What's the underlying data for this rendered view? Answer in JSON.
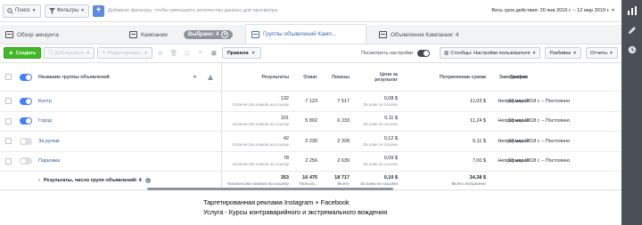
{
  "topbar": {
    "search_label": "Поиск",
    "filters_label": "Фильтры",
    "add_filter_hint": "Добавьте фильтры, чтобы уменьшить количество данных для просмотра",
    "date_range": "Весь срок действия: 20 янв 2016 г. – 12 мар 2019 г."
  },
  "tabs": {
    "overview": "Обзор аккаунта",
    "campaigns": "Кампании",
    "selected_pill": "Выбрано: 4",
    "adsets": "Группы объявлений Камп...",
    "ads": "Объявления Кампании: 4"
  },
  "toolbar": {
    "create": "Создать",
    "duplicate": "Дублировать",
    "edit": "Редактировать",
    "rules": "Правила",
    "view_settings": "Посмотреть настройки",
    "columns": "Столбцы: Настройки пользователя",
    "breakdown": "Разбивка",
    "reports": "Отчеты"
  },
  "table": {
    "headers": {
      "name": "Название группы объявлений",
      "results": "Результаты",
      "reach": "Охват",
      "impressions": "Показы",
      "cost": "Цена за результат",
      "spend": "Потраченная сумма",
      "end": "Завершение",
      "schedule": "График"
    },
    "rows": [
      {
        "name": "Контр",
        "active": true,
        "results": "132",
        "results_sub": "Количество кликов на ссылку",
        "reach": "7 123",
        "impressions": "7 517",
        "cost": "0,08 $",
        "cost_sub": "За клик по ссылке",
        "spend": "11,03 $",
        "end": "Непрерывная",
        "schedule": "13 мар 2018 г. – Постоянно"
      },
      {
        "name": "Город",
        "active": true,
        "results": "101",
        "results_sub": "Количество кликов на ссылку",
        "reach": "5 802",
        "impressions": "6 233",
        "cost": "0,11 $",
        "cost_sub": "За клик по ссылке",
        "spend": "11,24 $",
        "end": "Непрерывная",
        "schedule": "13 мар 2018 г. – Постоянно"
      },
      {
        "name": "За рулем",
        "active": false,
        "results": "42",
        "results_sub": "Количество кликов на ссылку",
        "reach": "2 235",
        "impressions": "2 328",
        "cost": "0,12 $",
        "cost_sub": "За клик по ссылке",
        "spend": "5,11 $",
        "end": "Непрерывная",
        "schedule": "13 мар 2018 г. – Постоянно"
      },
      {
        "name": "Парковка",
        "active": false,
        "results": "78",
        "results_sub": "Количество кликов на ссылку",
        "reach": "2 256",
        "impressions": "2 639",
        "cost": "0,09 $",
        "cost_sub": "За клик по ссылке",
        "spend": "7,00 $",
        "end": "Непрерывная",
        "schedule": "13 мар 2018 г. – Постоянно"
      }
    ],
    "total": {
      "label": "Результаты, число групп объявлений: 4",
      "results": "353",
      "results_sub": "Количество кликов на ссылку",
      "reach": "16 475",
      "reach_sub": "Пользо...",
      "impressions": "18 717",
      "impressions_sub": "Всего",
      "cost": "0,10 $",
      "cost_sub": "За клик по ссылке",
      "spend": "34,38 $",
      "spend_sub": "Всего потрачено"
    }
  },
  "caption": {
    "line1": "Таргетированная реклама Instagram + Facebook",
    "line2": "Услуга - Курсы контраварийного и экстремального вождения"
  },
  "colors": {
    "accent": "#4267b2",
    "create": "#42b72a",
    "sidebar": "#4b4f56",
    "toggle_on": "#4080ff"
  }
}
